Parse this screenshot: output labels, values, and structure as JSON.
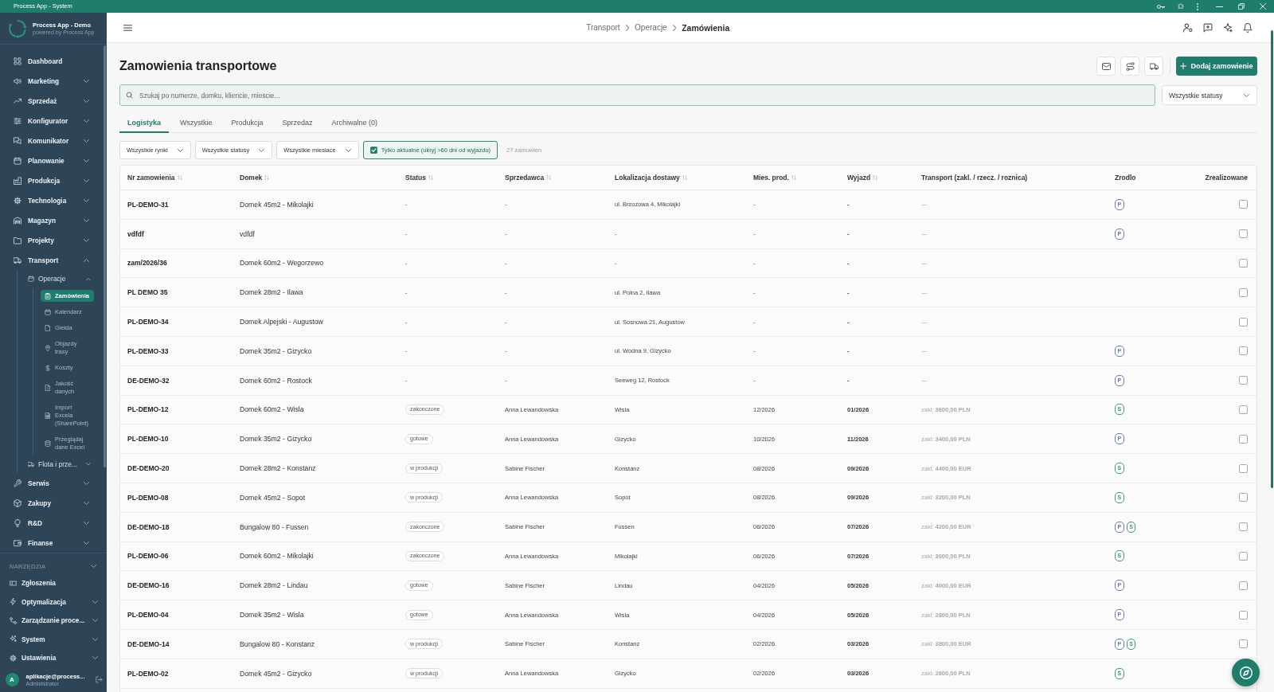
{
  "window": {
    "title": "Process App - System"
  },
  "sidebar": {
    "brand": {
      "title": "Process App - Demo",
      "subtitle": "powered by Process App"
    },
    "items": [
      {
        "label": "Dashboard"
      },
      {
        "label": "Marketing",
        "expanded": false
      },
      {
        "label": "Sprzedaż",
        "expanded": false
      },
      {
        "label": "Konfigurator",
        "expanded": false
      },
      {
        "label": "Komunikator",
        "expanded": false
      },
      {
        "label": "Planowanie",
        "expanded": false
      },
      {
        "label": "Produkcja",
        "expanded": false
      },
      {
        "label": "Technologia",
        "expanded": false
      },
      {
        "label": "Magazyn",
        "expanded": false
      },
      {
        "label": "Projekty",
        "expanded": false
      },
      {
        "label": "Transport",
        "expanded": true,
        "children": [
          {
            "label": "Operacje",
            "expanded": true,
            "children": [
              {
                "label": "Zamówienia",
                "selected": true
              },
              {
                "label": "Kalendarz",
                "selected": false
              },
              {
                "label": "Giełda",
                "selected": false
              },
              {
                "label": "Objazdy trasy",
                "selected": false
              },
              {
                "label": "Koszty",
                "selected": false
              },
              {
                "label": "Jakość danych",
                "selected": false
              },
              {
                "label": "Import Excela (SharePoint)",
                "selected": false
              },
              {
                "label": "Przeglądaj dane Excel",
                "selected": false
              }
            ]
          },
          {
            "label": "Flota i prze...",
            "expanded": false
          }
        ]
      },
      {
        "label": "Serwis",
        "expanded": false
      },
      {
        "label": "Zakupy",
        "expanded": false
      },
      {
        "label": "R&D",
        "expanded": false
      },
      {
        "label": "Finanse",
        "expanded": false
      }
    ],
    "tools": {
      "title": "NARZĘDZIA",
      "items": [
        {
          "label": "Zgłoszenia"
        },
        {
          "label": "Optymalizacja",
          "expanded": false
        },
        {
          "label": "Zarządzanie proce...",
          "expanded": false
        },
        {
          "label": "System",
          "expanded": false
        },
        {
          "label": "Ustawienia",
          "expanded": false
        }
      ]
    },
    "user": {
      "initial": "A",
      "name": "aplikacje@process...",
      "role": "Administrator"
    }
  },
  "header": {
    "breadcrumb": [
      "Transport",
      "Operacje",
      "Zamówienia"
    ]
  },
  "page": {
    "title": "Zamowienia transportowe",
    "add_button": "Dodaj zamowienie"
  },
  "search": {
    "placeholder": "Szukaj po numerze, domku, kliencie, miescie...",
    "status_select": "Wszystkie statusy"
  },
  "tabs": [
    {
      "label": "Logistyka",
      "selected": true
    },
    {
      "label": "Wszystkie",
      "selected": false
    },
    {
      "label": "Produkcja",
      "selected": false
    },
    {
      "label": "Sprzedaz",
      "selected": false
    },
    {
      "label": "Archiwalne (0)",
      "selected": false
    }
  ],
  "filters": [
    {
      "kind": "select",
      "value": "Wszystkie rynki"
    },
    {
      "kind": "select",
      "value": "Wszystkie statusy"
    },
    {
      "kind": "select",
      "value": "Wszystkie miesiace"
    },
    {
      "kind": "checkbox",
      "label": "Tylko aktualne (ukryj >60 dni od wyjazdu)",
      "checked": true
    }
  ],
  "order_count": "27 zamowien",
  "table": {
    "columns": [
      {
        "label": "Nr zamowienia",
        "sortable": true
      },
      {
        "label": "Domek",
        "sortable": true
      },
      {
        "label": "Status",
        "sortable": true
      },
      {
        "label": "Sprzedawca",
        "sortable": true
      },
      {
        "label": "Lokalizacja dostawy",
        "sortable": true
      },
      {
        "label": "Mies. prod.",
        "sortable": true
      },
      {
        "label": "Wyjazd",
        "sortable": true
      },
      {
        "label": "Transport (zakl. / rzecz. / roznica)",
        "sortable": false
      },
      {
        "label": "Zrodlo",
        "sortable": false
      },
      {
        "label": "Zrealizowane",
        "sortable": false
      }
    ],
    "rows": [
      {
        "number": "PL-DEMO-31",
        "house": "Domek 45m2 - Mikolajki",
        "status": {
          "kind": "text",
          "text": "-"
        },
        "seller": "-",
        "location": "ul. Brzozowa 4, Mikolajki",
        "production_month": "-",
        "departure": "-",
        "transport": "—",
        "sources": [
          {
            "label": "P",
            "color": "#6b78b4"
          }
        ],
        "checked": false
      },
      {
        "number": "vdfdf",
        "house": "vdfdf",
        "status": {
          "kind": "text",
          "text": "-"
        },
        "seller": "-",
        "location": "-",
        "production_month": "-",
        "departure": "-",
        "transport": "—",
        "sources": [
          {
            "label": "P",
            "color": "#6b78b4"
          }
        ],
        "checked": false
      },
      {
        "number": "zam/2026/36",
        "house": "Domek 60m2 - Wegorzewo",
        "status": {
          "kind": "text",
          "text": "-"
        },
        "seller": "-",
        "location": "-",
        "production_month": "-",
        "departure": "-",
        "transport": "—",
        "checked": false
      },
      {
        "number": "PL DEMO 35",
        "house": "Domek 28m2 - Ilawa",
        "status": {
          "kind": "text",
          "text": "-"
        },
        "seller": "-",
        "location": "ul. Polna 2, Ilawa",
        "production_month": "-",
        "departure": "-",
        "transport": "—",
        "checked": false
      },
      {
        "number": "PL-DEMO-34",
        "house": "Domek Alpejski - Augustow",
        "status": {
          "kind": "text",
          "text": "-"
        },
        "seller": "-",
        "location": "ul. Sosnowa 21, Augustow",
        "production_month": "-",
        "departure": "-",
        "transport": "—",
        "checked": false
      },
      {
        "number": "PL-DEMO-33",
        "house": "Domek 35m2 - Gizycko",
        "status": {
          "kind": "text",
          "text": "-"
        },
        "seller": "-",
        "location": "ul. Wodna 9, Gizycko",
        "production_month": "-",
        "departure": "-",
        "transport": "—",
        "sources": [
          {
            "label": "P",
            "color": "#6b78b4"
          }
        ],
        "checked": false
      },
      {
        "number": "DE-DEMO-32",
        "house": "Domek 60m2 - Rostock",
        "status": {
          "kind": "text",
          "text": "-"
        },
        "seller": "-",
        "location": "Seeweg 12, Rostock",
        "production_month": "-",
        "departure": "-",
        "transport": "—",
        "sources": [
          {
            "label": "P",
            "color": "#6b78b4"
          }
        ],
        "checked": false
      },
      {
        "number": "PL-DEMO-12",
        "house": "Domek 60m2 - Wisla",
        "status": {
          "kind": "badge",
          "text": "zakonczone"
        },
        "seller": "Anna Lewandowska",
        "location": "Wisla",
        "production_month": "12/2026",
        "departure": "01/2026",
        "transport": "zakl: **3600,00 PLN**",
        "sources": [
          {
            "label": "S",
            "color": "#3a9a74"
          }
        ],
        "checked": false
      },
      {
        "number": "PL-DEMO-10",
        "house": "Domek 35m2 - Gizycko",
        "status": {
          "kind": "badge",
          "text": "gotowe"
        },
        "seller": "Anna Lewandowska",
        "location": "Gizycko",
        "production_month": "10/2026",
        "departure": "11/2026",
        "transport": "zakl: **3400,00 PLN**",
        "sources": [
          {
            "label": "P",
            "color": "#6b78b4"
          }
        ],
        "checked": false
      },
      {
        "number": "DE-DEMO-20",
        "house": "Domek 28m2 - Konstanz",
        "status": {
          "kind": "badge",
          "text": "w produkcji"
        },
        "seller": "Sabine Fischer",
        "location": "Konstanz",
        "production_month": "08/2026",
        "departure": "09/2026",
        "transport": "zakl: **4400,00 EUR**",
        "sources": [
          {
            "label": "S",
            "color": "#3a9a74"
          }
        ],
        "checked": false
      },
      {
        "number": "PL-DEMO-08",
        "house": "Domek 45m2 - Sopot",
        "status": {
          "kind": "badge",
          "text": "w produkcji"
        },
        "seller": "Anna Lewandowska",
        "location": "Sopot",
        "production_month": "08/2026",
        "departure": "09/2026",
        "transport": "zakl: **3200,00 PLN**",
        "sources": [
          {
            "label": "S",
            "color": "#3a9a74"
          }
        ],
        "checked": false
      },
      {
        "number": "DE-DEMO-18",
        "house": "Bungalow 80 - Fussen",
        "status": {
          "kind": "badge",
          "text": "zakonczone"
        },
        "seller": "Sabine Fischer",
        "location": "Fussen",
        "production_month": "06/2026",
        "departure": "07/2026",
        "transport": "zakl: **4200,00 EUR**",
        "sources": [
          {
            "label": "P",
            "color": "#6b78b4"
          },
          {
            "label": "S",
            "color": "#3a9a74"
          }
        ],
        "checked": false
      },
      {
        "number": "PL-DEMO-06",
        "house": "Domek 60m2 - Mikolajki",
        "status": {
          "kind": "badge",
          "text": "zakonczone"
        },
        "seller": "Anna Lewandowska",
        "location": "Mikolajki",
        "production_month": "06/2026",
        "departure": "07/2026",
        "transport": "zakl: **3000,00 PLN**",
        "sources": [
          {
            "label": "S",
            "color": "#3a9a74"
          }
        ],
        "checked": false
      },
      {
        "number": "DE-DEMO-16",
        "house": "Domek 28m2 - Lindau",
        "status": {
          "kind": "badge",
          "text": "gotowe"
        },
        "seller": "Sabine Fischer",
        "location": "Lindau",
        "production_month": "04/2026",
        "departure": "05/2026",
        "transport": "zakl: **4000,00 EUR**",
        "sources": [
          {
            "label": "P",
            "color": "#6b78b4"
          }
        ],
        "checked": false
      },
      {
        "number": "PL-DEMO-04",
        "house": "Domek 35m2 - Wisla",
        "status": {
          "kind": "badge",
          "text": "gotowe"
        },
        "seller": "Anna Lewandowska",
        "location": "Wisla",
        "production_month": "04/2026",
        "departure": "05/2026",
        "transport": "zakl: **2800,00 PLN**",
        "sources": [
          {
            "label": "P",
            "color": "#6b78b4"
          }
        ],
        "checked": false
      },
      {
        "number": "DE-DEMO-14",
        "house": "Bungalow 80 - Konstanz",
        "status": {
          "kind": "badge",
          "text": "w produkcji"
        },
        "seller": "Sabine Fischer",
        "location": "Konstanz",
        "production_month": "02/2026",
        "departure": "03/2026",
        "transport": "zakl: **3800,00 EUR**",
        "sources": [
          {
            "label": "P",
            "color": "#6b78b4"
          },
          {
            "label": "S",
            "color": "#3a9a74"
          }
        ],
        "checked": false
      },
      {
        "number": "PL-DEMO-02",
        "house": "Domek 45m2 - Gizycko",
        "status": {
          "kind": "badge",
          "text": "w produkcji"
        },
        "seller": "Anna Lewandowska",
        "location": "Gizycko",
        "production_month": "02/2026",
        "departure": "03/2026",
        "transport": "zakl: **2600,00 PLN**",
        "sources": [
          {
            "label": "S",
            "color": "#3a9a74"
          }
        ]
      }
    ]
  }
}
